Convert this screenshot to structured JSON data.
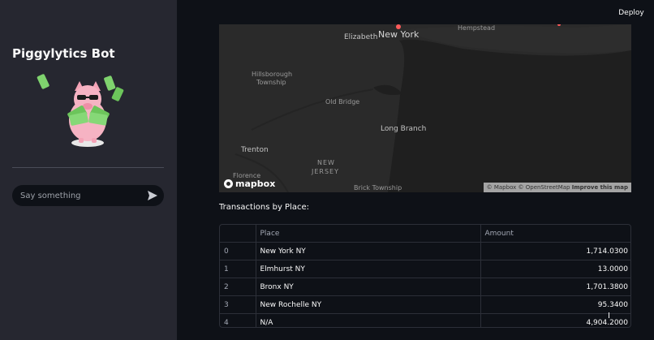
{
  "sidebar": {
    "title": "Piggylytics Bot",
    "chat": {
      "placeholder": "Say something",
      "send_icon": "send-icon"
    }
  },
  "header": {
    "deploy_label": "Deploy"
  },
  "map": {
    "labels": {
      "new_york": "New York",
      "elizabeth": "Elizabeth",
      "hempstead": "Hempstead",
      "hillsborough": "Hillsborough",
      "township": "Township",
      "old_bridge": "Old Bridge",
      "long_branch": "Long Branch",
      "trenton": "Trenton",
      "new": "NEW",
      "jersey": "JERSEY",
      "florence": "Florence",
      "brick_township": "Brick Township"
    },
    "logo": "mapbox",
    "attribution": {
      "mapbox": "© Mapbox",
      "osm": "© OpenStreetMap",
      "improve": "Improve this map"
    }
  },
  "transactions": {
    "title": "Transactions by Place:",
    "columns": {
      "index": "",
      "place": "Place",
      "amount": "Amount"
    },
    "rows": [
      {
        "index": "0",
        "place": "New York NY",
        "amount": "1,714.0300"
      },
      {
        "index": "1",
        "place": "Elmhurst NY",
        "amount": "13.0000"
      },
      {
        "index": "2",
        "place": "Bronx NY",
        "amount": "1,701.3800"
      },
      {
        "index": "3",
        "place": "New Rochelle NY",
        "amount": "95.3400"
      },
      {
        "index": "4",
        "place": "N/A",
        "amount": "4,904.2000"
      }
    ]
  },
  "colors": {
    "background": "#0e1117",
    "sidebar": "#262730",
    "text": "#fafafa",
    "map_land": "#2a2a2a",
    "map_water": "#1f1f1f"
  }
}
